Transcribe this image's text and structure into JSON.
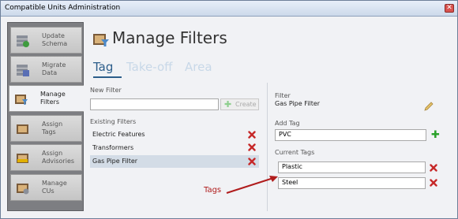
{
  "window": {
    "title": "Compatible Units Administration",
    "close_symbol": "✕"
  },
  "sidebar": {
    "items": [
      {
        "label_line1": "Update",
        "label_line2": "Schema",
        "icon": "update-schema-icon"
      },
      {
        "label_line1": "Migrate",
        "label_line2": "Data",
        "icon": "migrate-data-icon"
      },
      {
        "label_line1": "Manage",
        "label_line2": "Filters",
        "icon": "manage-filters-icon",
        "active": true
      },
      {
        "label_line1": "Assign",
        "label_line2": "Tags",
        "icon": "assign-tags-icon"
      },
      {
        "label_line1": "Assign",
        "label_line2": "Advisories",
        "icon": "assign-advisories-icon"
      },
      {
        "label_line1": "Manage",
        "label_line2": "CUs",
        "icon": "manage-cus-icon"
      }
    ]
  },
  "main": {
    "title": "Manage Filters",
    "tabs": [
      {
        "label": "Tag",
        "active": true
      },
      {
        "label": "Take-off",
        "active": false
      },
      {
        "label": "Area",
        "active": false
      }
    ],
    "new_filter": {
      "label": "New Filter",
      "value": "",
      "create_label": "Create"
    },
    "existing_filters": {
      "label": "Existing Filters",
      "items": [
        {
          "name": "Electric Features",
          "selected": false
        },
        {
          "name": "Transformers",
          "selected": false
        },
        {
          "name": "Gas Pipe Filter",
          "selected": true
        }
      ]
    },
    "filter_detail": {
      "filter_label": "Filter",
      "filter_name": "Gas Pipe Filter",
      "add_tag_label": "Add Tag",
      "add_tag_value": "PVC",
      "current_tags_label": "Current Tags",
      "current_tags": [
        "Plastic",
        "Steel"
      ]
    }
  },
  "annotation": {
    "text": "Tags",
    "color": "#b01c1c"
  },
  "colors": {
    "accent": "#2c5d8a",
    "tab_inactive": "#c8d8e8",
    "delete": "#c62828",
    "add": "#2aa12a"
  }
}
